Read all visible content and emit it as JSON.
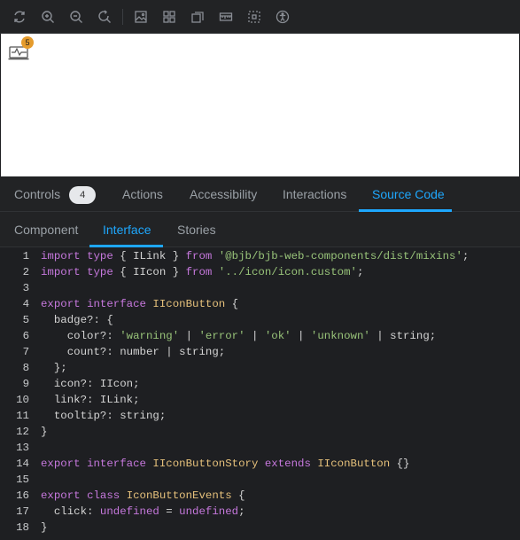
{
  "toolbar": {
    "icons": [
      "reload-icon",
      "zoom-in-icon",
      "zoom-out-icon",
      "reset-zoom-icon",
      "background-icon",
      "grid-icon",
      "viewport-icon",
      "ruler-icon",
      "outline-icon",
      "accessibility-icon"
    ]
  },
  "canvas": {
    "badge": "5"
  },
  "addon_tabs": {
    "controls": "Controls",
    "controls_count": "4",
    "actions": "Actions",
    "accessibility": "Accessibility",
    "interactions": "Interactions",
    "source_code": "Source Code",
    "active": "Source Code"
  },
  "code_tabs": {
    "component": "Component",
    "interface": "Interface",
    "stories": "Stories",
    "active": "Interface"
  },
  "code": {
    "line_numbers": [
      "1",
      "2",
      "3",
      "4",
      "5",
      "6",
      "7",
      "8",
      "9",
      "10",
      "11",
      "12",
      "13",
      "14",
      "15",
      "16",
      "17",
      "18"
    ],
    "lines": [
      [
        [
          "k",
          "import"
        ],
        [
          "p",
          " "
        ],
        [
          "k",
          "type"
        ],
        [
          "p",
          " { ILink } "
        ],
        [
          "k",
          "from"
        ],
        [
          "p",
          " "
        ],
        [
          "s",
          "'@bjb/bjb-web-components/dist/mixins'"
        ],
        [
          "p",
          ";"
        ]
      ],
      [
        [
          "k",
          "import"
        ],
        [
          "p",
          " "
        ],
        [
          "k",
          "type"
        ],
        [
          "p",
          " { IIcon } "
        ],
        [
          "k",
          "from"
        ],
        [
          "p",
          " "
        ],
        [
          "s",
          "'../icon/icon.custom'"
        ],
        [
          "p",
          ";"
        ]
      ],
      [],
      [
        [
          "k",
          "export"
        ],
        [
          "p",
          " "
        ],
        [
          "k",
          "interface"
        ],
        [
          "p",
          " "
        ],
        [
          "ty",
          "IIconButton"
        ],
        [
          "p",
          " {"
        ]
      ],
      [
        [
          "p",
          "  badge?: {"
        ]
      ],
      [
        [
          "p",
          "    color?: "
        ],
        [
          "s",
          "'warning'"
        ],
        [
          "p",
          " | "
        ],
        [
          "s",
          "'error'"
        ],
        [
          "p",
          " | "
        ],
        [
          "s",
          "'ok'"
        ],
        [
          "p",
          " | "
        ],
        [
          "s",
          "'unknown'"
        ],
        [
          "p",
          " | string;"
        ]
      ],
      [
        [
          "p",
          "    count?: number | string;"
        ]
      ],
      [
        [
          "p",
          "  };"
        ]
      ],
      [
        [
          "p",
          "  icon?: IIcon;"
        ]
      ],
      [
        [
          "p",
          "  link?: ILink;"
        ]
      ],
      [
        [
          "p",
          "  tooltip?: string;"
        ]
      ],
      [
        [
          "p",
          "}"
        ]
      ],
      [],
      [
        [
          "k",
          "export"
        ],
        [
          "p",
          " "
        ],
        [
          "k",
          "interface"
        ],
        [
          "p",
          " "
        ],
        [
          "ty",
          "IIconButtonStory"
        ],
        [
          "p",
          " "
        ],
        [
          "k",
          "extends"
        ],
        [
          "p",
          " "
        ],
        [
          "ty",
          "IIconButton"
        ],
        [
          "p",
          " {}"
        ]
      ],
      [],
      [
        [
          "k",
          "export"
        ],
        [
          "p",
          " "
        ],
        [
          "k",
          "class"
        ],
        [
          "p",
          " "
        ],
        [
          "ty",
          "IconButtonEvents"
        ],
        [
          "p",
          " {"
        ]
      ],
      [
        [
          "p",
          "  click: "
        ],
        [
          "k",
          "undefined"
        ],
        [
          "p",
          " = "
        ],
        [
          "k",
          "undefined"
        ],
        [
          "p",
          ";"
        ]
      ],
      [
        [
          "p",
          "}"
        ]
      ]
    ]
  }
}
